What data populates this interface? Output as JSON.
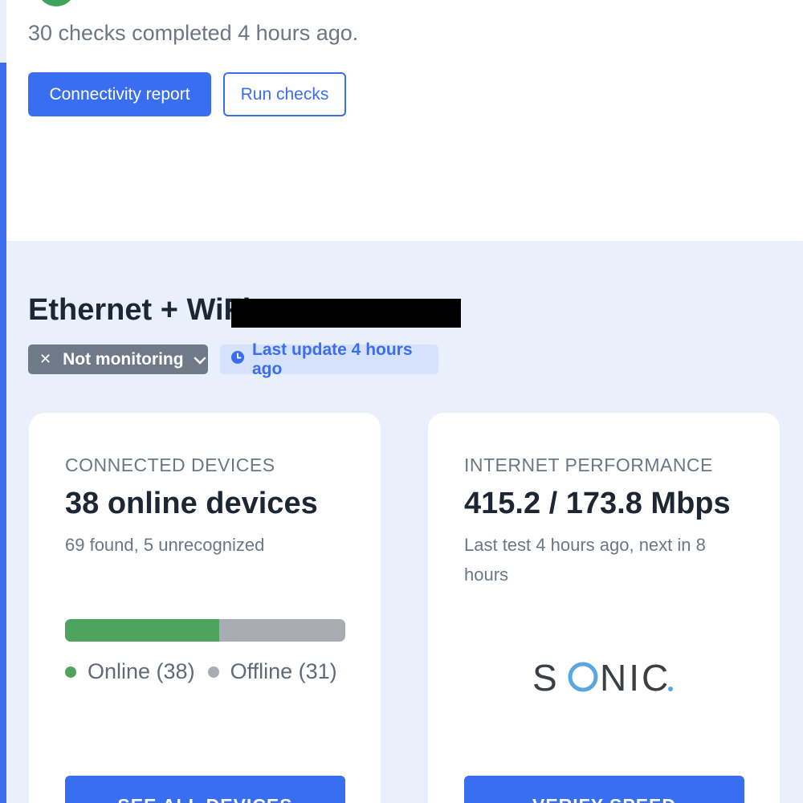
{
  "header": {
    "checks_summary": "30 checks completed 4 hours ago.",
    "connectivity_report_label": "Connectivity report",
    "run_checks_label": "Run checks"
  },
  "network": {
    "title": "Ethernet + WiFi",
    "monitoring_badge": "Not monitoring",
    "last_update_badge": "Last update 4 hours ago"
  },
  "devices_card": {
    "label": "CONNECTED DEVICES",
    "value": "38 online devices",
    "subtitle": "69 found, 5 unrecognized",
    "online_count": 38,
    "offline_count": 31,
    "online_legend": "Online (38)",
    "offline_legend": "Offline (31)",
    "button_label": "SEE ALL DEVICES"
  },
  "performance_card": {
    "label": "INTERNET PERFORMANCE",
    "value": "415.2 / 173.8 Mbps",
    "subtitle": "Last test 4 hours ago, next in 8 hours",
    "provider_logo_text": "SONIC.",
    "button_label": "VERIFY SPEED"
  },
  "colors": {
    "accent": "#3a6ef0",
    "online": "#4ea45c",
    "offline": "#a9adb3",
    "section_bg": "#e9f0fc"
  },
  "icons": [
    "status-check-icon",
    "close-icon",
    "chevron-down-icon",
    "clock-icon"
  ]
}
